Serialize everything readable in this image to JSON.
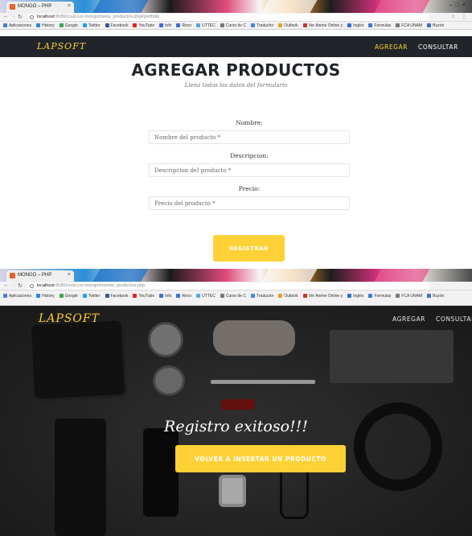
{
  "browser_top": {
    "tab_title": "MONGO – PHP",
    "url_host": "localhost",
    "url_path": ":8080/crud-cxx-mongo/menu_productos.php#portfolio"
  },
  "browser_bottom": {
    "tab_title": "MONGO – PHP",
    "url_host": "localhost",
    "url_path": ":8080/crud-cxx-mongo/insertar_productos.php"
  },
  "bookmarks": [
    {
      "label": "Aplicaciones",
      "color": "#4a7bd6"
    },
    {
      "label": "History",
      "color": "#2e86de"
    },
    {
      "label": "Google",
      "color": "#34a853"
    },
    {
      "label": "Twitter",
      "color": "#1da1f2"
    },
    {
      "label": "Facebook",
      "color": "#3b5998"
    },
    {
      "label": "YouTube",
      "color": "#e62117"
    },
    {
      "label": "Info",
      "color": "#3c6fd1"
    },
    {
      "label": "Reco",
      "color": "#3c6fd1"
    },
    {
      "label": "UTTEC",
      "color": "#5aa7e0"
    },
    {
      "label": "Curso de C",
      "color": "#777777"
    },
    {
      "label": "Traductor",
      "color": "#4285f4"
    },
    {
      "label": "Outlook",
      "color": "#e4a12b"
    },
    {
      "label": "Ver Anime Online y",
      "color": "#c0392b"
    },
    {
      "label": "Inglés",
      "color": "#2f6fd6"
    },
    {
      "label": "Formulas",
      "color": "#3a7bd5"
    },
    {
      "label": "FCA UNAM",
      "color": "#777777"
    },
    {
      "label": "Buzón",
      "color": "#3c6fd1"
    }
  ],
  "nav": {
    "brand": "LAPSOFT",
    "agregar": "AGREGAR",
    "consultar": "CONSULTAR"
  },
  "form": {
    "title": "AGREGAR PRODUCTOS",
    "subtitle": "Llena todos los datos del formulario",
    "nombre_label": "Nombre:",
    "nombre_placeholder": "Nombre del producto *",
    "descripcion_label": "Descripcion:",
    "descripcion_placeholder": "Descripcion del producto *",
    "precio_label": "Precio:",
    "precio_placeholder": "Precio del producto *",
    "submit": "REGISTRAR"
  },
  "success": {
    "message": "Registro exitoso!!!",
    "button": "VOLVER A INSERTAR UN PRODUCTO"
  },
  "colors": {
    "accent": "#fed136",
    "navbar": "#212529",
    "heading": "#212529"
  }
}
